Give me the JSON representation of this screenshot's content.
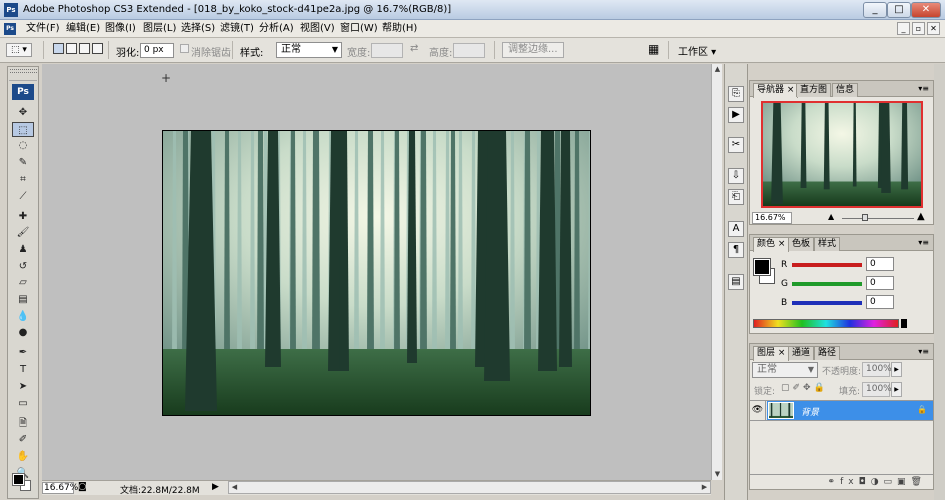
{
  "window": {
    "app_icon": "Ps",
    "title": "Adobe Photoshop CS3 Extended - [018_by_koko_stock-d41pe2a.jpg @ 16.7%(RGB/8)]",
    "controls": [
      "_",
      "□",
      "✕"
    ]
  },
  "menu": {
    "items": [
      "文件(F)",
      "编辑(E)",
      "图像(I)",
      "图层(L)",
      "选择(S)",
      "滤镜(T)",
      "分析(A)",
      "视图(V)",
      "窗口(W)",
      "帮助(H)"
    ]
  },
  "options": {
    "feather_label": "羽化:",
    "feather_value": "0 px",
    "antialias_label": "消除锯齿",
    "style_label": "样式:",
    "style_value": "正常",
    "width_label": "宽度:",
    "height_label": "高度:",
    "refine_edge": "调整边缘...",
    "workspace_label": "工作区 ▾"
  },
  "toolbox": {
    "logo": "Ps",
    "tools": [
      {
        "name": "move-tool",
        "glyph": "✥"
      },
      {
        "name": "marquee-tool",
        "glyph": "⬚"
      },
      {
        "name": "lasso-tool",
        "glyph": "◌"
      },
      {
        "name": "quick-select-tool",
        "glyph": "✎"
      },
      {
        "name": "crop-tool",
        "glyph": "⌗"
      },
      {
        "name": "eyedropper-tool",
        "glyph": "⟋"
      },
      {
        "name": "healing-tool",
        "glyph": "✚"
      },
      {
        "name": "brush-tool",
        "glyph": "🖌"
      },
      {
        "name": "stamp-tool",
        "glyph": "♟"
      },
      {
        "name": "history-brush-tool",
        "glyph": "↺"
      },
      {
        "name": "eraser-tool",
        "glyph": "▱"
      },
      {
        "name": "gradient-tool",
        "glyph": "▤"
      },
      {
        "name": "blur-tool",
        "glyph": "💧"
      },
      {
        "name": "dodge-tool",
        "glyph": "●"
      },
      {
        "name": "pen-tool",
        "glyph": "✒"
      },
      {
        "name": "type-tool",
        "glyph": "T"
      },
      {
        "name": "path-select-tool",
        "glyph": "➤"
      },
      {
        "name": "shape-tool",
        "glyph": "▭"
      },
      {
        "name": "notes-tool",
        "glyph": "🗎"
      },
      {
        "name": "eyedropper2-tool",
        "glyph": "✐"
      },
      {
        "name": "hand-tool",
        "glyph": "✋"
      },
      {
        "name": "zoom-tool",
        "glyph": "🔍"
      }
    ]
  },
  "status": {
    "zoom": "16.67%",
    "doc_info": "文档:22.8M/22.8M"
  },
  "navigator": {
    "tabs": [
      "导航器 ×",
      "直方图",
      "信息"
    ],
    "zoom": "16.67%"
  },
  "color_panel": {
    "tabs": [
      "颜色 ×",
      "色板",
      "样式"
    ],
    "channels": [
      {
        "label": "R",
        "value": "0",
        "color": "#c81e1e"
      },
      {
        "label": "G",
        "value": "0",
        "color": "#1f9a2a"
      },
      {
        "label": "B",
        "value": "0",
        "color": "#1e2fb8"
      }
    ]
  },
  "layers_panel": {
    "tabs": [
      "图层 ×",
      "通道",
      "路径"
    ],
    "blend_mode": "正常",
    "opacity_label": "不透明度:",
    "opacity_value": "100%",
    "lock_label": "锁定:",
    "fill_label": "填充:",
    "fill_value": "100%",
    "layer_name": "背景",
    "selected_color": "#3d8fe8"
  }
}
